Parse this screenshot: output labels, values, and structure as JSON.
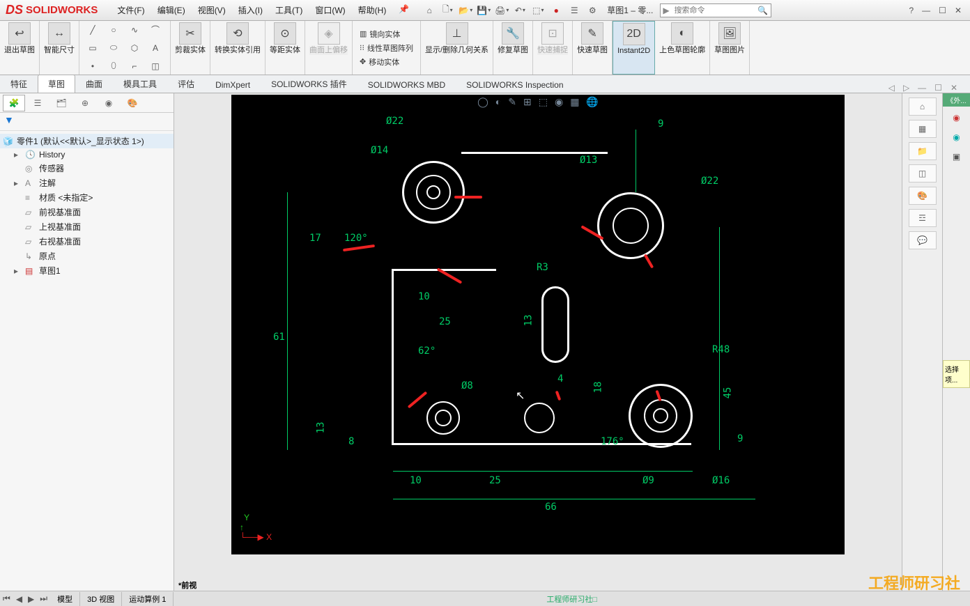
{
  "app": {
    "name": "SOLIDWORKS"
  },
  "menu": [
    "文件(F)",
    "编辑(E)",
    "视图(V)",
    "插入(I)",
    "工具(T)",
    "窗口(W)",
    "帮助(H)"
  ],
  "doc_title": "草图1 – 零...",
  "search_placeholder": "搜索命令",
  "ribbon": {
    "exit_sketch": "退出草图",
    "smart_dim": "智能尺寸",
    "trim": "剪裁实体",
    "convert": "转换实体引用",
    "offset": "等距实体",
    "surface_offset": "曲面上偏移",
    "mirror": "镜向实体",
    "linear_pattern": "线性草图阵列",
    "move": "移动实体",
    "show_relations": "显示/删除几何关系",
    "repair": "修复草图",
    "quick_snap": "快速捕捉",
    "rapid": "快速草图",
    "instant2d": "Instant2D",
    "shaded": "上色草图轮廓",
    "picture": "草图图片"
  },
  "tabs": [
    "特征",
    "草图",
    "曲面",
    "模具工具",
    "评估",
    "DimXpert",
    "SOLIDWORKS 插件",
    "SOLIDWORKS MBD",
    "SOLIDWORKS Inspection"
  ],
  "active_tab": "草图",
  "feature_tree": {
    "root": "零件1 (默认<<默认>_显示状态 1>)",
    "items": [
      "History",
      "传感器",
      "注解",
      "材质 <未指定>",
      "前视基准面",
      "上视基准面",
      "右视基准面",
      "原点",
      "草图1"
    ]
  },
  "dimensions": {
    "d22a": "Ø22",
    "d14": "Ø14",
    "d13": "Ø13",
    "d22b": "Ø22",
    "v9": "9",
    "v17": "17",
    "a120": "120°",
    "v61": "61",
    "v10a": "10",
    "v25a": "25",
    "v13a": "13",
    "a62": "62°",
    "r3": "R3",
    "r48": "R48",
    "v4": "4",
    "v18": "18",
    "d8": "Ø8",
    "v45": "45",
    "v13b": "13",
    "v8": "8",
    "a176": "176°",
    "v9b": "9",
    "v10b": "10",
    "v25b": "25",
    "d9": "Ø9",
    "d16": "Ø16",
    "v66": "66"
  },
  "viewport_label": "*前视",
  "axes": {
    "y": "Y",
    "x": "X"
  },
  "bottom_tabs": [
    "模型",
    "3D 视图",
    "运动算例 1"
  ],
  "status_text": "工程师研习社□",
  "watermark": "工程师研习社",
  "right_side": {
    "header": "《外...",
    "select": "选择项..."
  }
}
